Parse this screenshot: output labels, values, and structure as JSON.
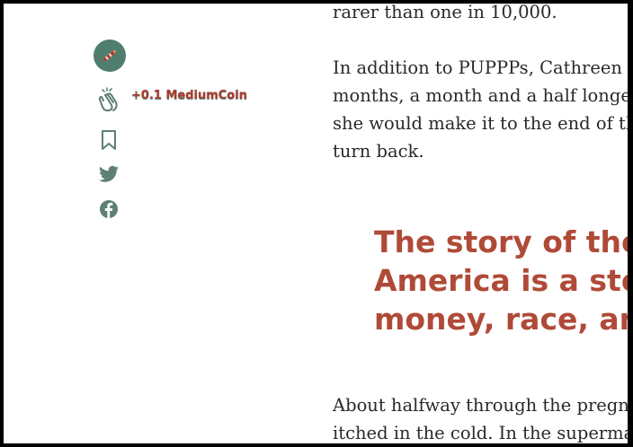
{
  "rail": {
    "coin_label": "+0.1 MediumCoin"
  },
  "article": {
    "para0": [
      "rarer than one in 10,000."
    ],
    "para1": [
      "In addition to PUPPPs, Cathreen had",
      "months, a month and a half longer th",
      "she would make it to the end of the d",
      "turn back."
    ],
    "quote": [
      "The story of the",
      "America is a sto",
      "money, race, and"
    ],
    "para3": [
      "About halfway through the pregnanc",
      "itched in the cold. In the supermarke"
    ]
  },
  "colors": {
    "badge": "#4f7d6e",
    "accent": "#b04a38",
    "icon": "#5e7f75",
    "text": "#292929"
  },
  "icons": {
    "badge": "pencil-icon",
    "clap": "clap-icon",
    "bookmark": "bookmark-icon",
    "twitter": "twitter-icon",
    "facebook": "facebook-icon"
  }
}
